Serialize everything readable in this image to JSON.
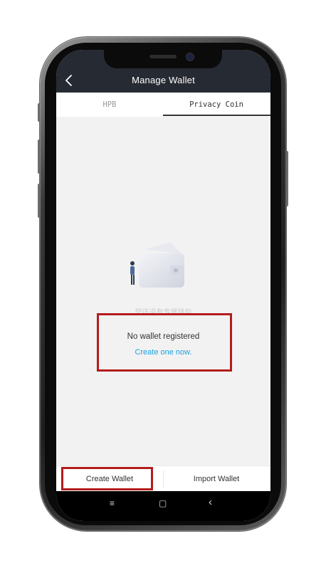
{
  "header": {
    "title": "Manage Wallet",
    "back_icon": "chevron-left-icon"
  },
  "tabs": [
    {
      "label": "HPB",
      "active": false
    },
    {
      "label": "Privacy Coin",
      "active": true
    }
  ],
  "empty_state": {
    "illustration": "wallet-person-illustration",
    "hint": "您还没有专属钱包",
    "title": "No wallet registered",
    "action": "Create one now."
  },
  "bottom_actions": {
    "create": "Create Wallet",
    "import": "Import Wallet"
  },
  "android_nav": {
    "menu_icon": "≡",
    "home_icon": "▢",
    "back_icon": "‹"
  },
  "colors": {
    "header_bg": "#262a33",
    "link": "#1aa3df",
    "highlight": "#b41c1c",
    "screen_bg": "#f2f2f3"
  }
}
